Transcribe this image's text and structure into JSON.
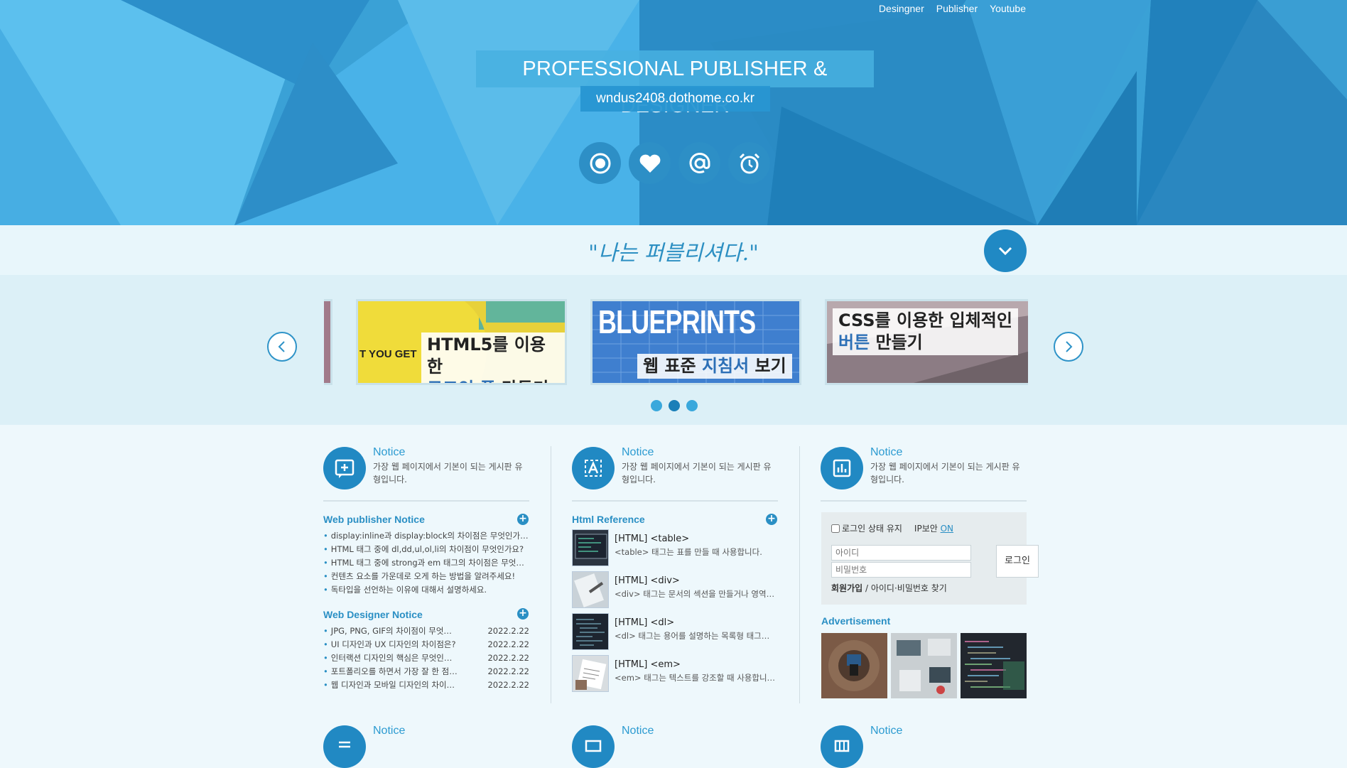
{
  "nav": {
    "items": [
      "Desingner",
      "Publisher",
      "Youtube"
    ]
  },
  "hero": {
    "title": "PROFESSIONAL PUBLISHER & DESIGNER",
    "url": "wndus2408.dothome.co.kr",
    "icons": [
      "record-icon",
      "heart-icon",
      "at-icon",
      "alarm-icon"
    ]
  },
  "slogan": "\"나는 퍼블리셔다.\"",
  "slides": [
    {
      "image_text": "T YOU GET",
      "cap_line1": "HTML5를 이용한",
      "cap_line2_hl": "로그인 폼",
      "cap_line2_rest": " 만들기"
    },
    {
      "image_text": "BLUEPRINTS",
      "cap_line1_a": "웹 표준 ",
      "cap_line1_hl": "지침서",
      "cap_line1_b": " 보기"
    },
    {
      "cap_line1": "CSS를 이용한 입체적인",
      "cap_line2_hl": "버튼",
      "cap_line2_rest": " 만들기"
    }
  ],
  "notices": [
    {
      "title": "Notice",
      "desc": "가장 웹 페이지에서 기본이 되는 게시판 유형입니다."
    },
    {
      "title": "Notice",
      "desc": "가장 웹 페이지에서 기본이 되는 게시판 유형입니다."
    },
    {
      "title": "Notice",
      "desc": "가장 웹 페이지에서 기본이 되는 게시판 유형입니다."
    }
  ],
  "publisher_notice": {
    "title": "Web publisher Notice",
    "items": [
      "display:inline과 display:block의 차이점은 무엇인가요?",
      "HTML 태그 중에 dl,dd,ul,ol,li의 차이점이 무엇인가요?",
      "HTML 태그 중에 strong과 em 태그의 차이점은 무엇인가요?",
      "컨텐츠 요소를 가운데로 오게 하는 방법을 알려주세요!",
      "독타입을 선언하는 이유에 대해서 설명하세요."
    ]
  },
  "designer_notice": {
    "title": "Web Designer Notice",
    "items": [
      {
        "text": "JPG, PNG, GIF의 차이점이 무엇인가요?",
        "date": "2022.2.22"
      },
      {
        "text": "UI 디자인과 UX 디자인의 차이점은?",
        "date": "2022.2.22"
      },
      {
        "text": "인터랙션 디자인의 핵심은 무엇인가요?",
        "date": "2022.2.22"
      },
      {
        "text": "포트폴리오를 하면서 가장 잘 한 점은?",
        "date": "2022.2.22"
      },
      {
        "text": "웹 디자인과 모바일 디자인의 차이점은?",
        "date": "2022.2.22"
      }
    ]
  },
  "html_reference": {
    "title": "Html Reference",
    "items": [
      {
        "title": "[HTML] <table>",
        "desc": "<table> 태그는 표를 만들 때 사용합니다."
      },
      {
        "title": "[HTML] <div>",
        "desc": "<div> 태그는 문서의 섹션을 만들거나 영역을 나눌 때 사용합니다."
      },
      {
        "title": "[HTML] <dl>",
        "desc": "<dl> 태그는 용어를 설명하는 목록형 태그입니다."
      },
      {
        "title": "[HTML] <em>",
        "desc": "<em> 태그는 텍스트를 강조할 때 사용합니다."
      }
    ]
  },
  "login": {
    "keep_label": "로그인 상태 유지",
    "ip_label": "IP보안",
    "ip_value": "ON",
    "id_placeholder": "아이디",
    "pw_placeholder": "비밀번호",
    "button": "로그인",
    "join": "회원가입",
    "sep": " / ",
    "find": "아이디·비밀번호 찾기"
  },
  "advertisement": {
    "title": "Advertisement"
  },
  "bottom_notices": [
    "Notice",
    "Notice",
    "Notice"
  ],
  "colors": {
    "primary": "#2189c3",
    "accent": "#2c9bd1",
    "background": "#eef8fc"
  }
}
